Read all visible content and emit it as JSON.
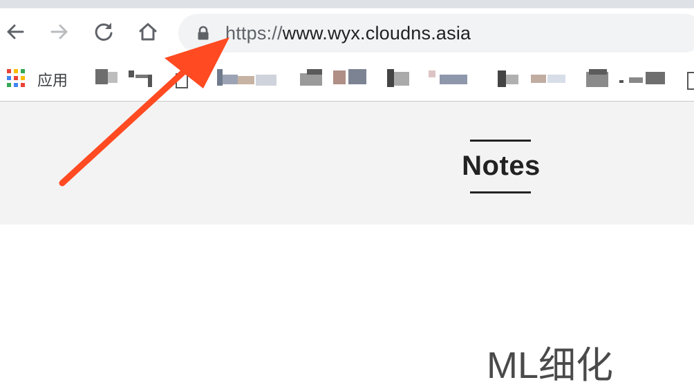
{
  "browser": {
    "nav": {
      "back_icon": "arrow-left-icon",
      "forward_icon": "arrow-right-icon",
      "reload_icon": "reload-icon",
      "home_icon": "home-icon"
    },
    "address_bar": {
      "lock_icon": "lock-icon",
      "scheme": "https://",
      "host": "www.wyx.cloudns.asia"
    },
    "bookmarks_bar": {
      "apps_icon": "apps-grid-icon",
      "apps_label": "应用"
    }
  },
  "page": {
    "header_title": "Notes",
    "post_title": "ML细化"
  },
  "annotation": {
    "arrow_color": "#ff4a22"
  },
  "colors": {
    "toolbar_bg": "#ffffff",
    "omnibox_bg": "#f1f3f4",
    "masthead_bg": "#f3f3f3",
    "title_text": "#222222"
  }
}
